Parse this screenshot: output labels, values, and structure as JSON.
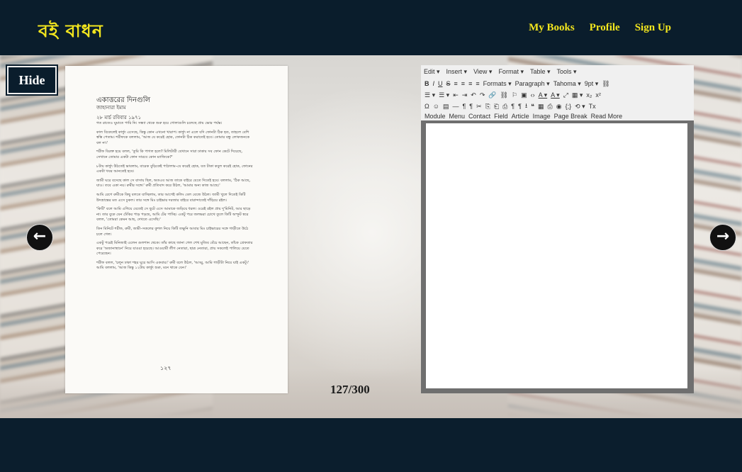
{
  "header": {
    "logo": "বই বাধন",
    "nav": [
      "My Books",
      "Profile",
      "Sign Up"
    ]
  },
  "controls": {
    "hide_label": "Hide",
    "prev_icon": "arrow-left-icon",
    "next_icon": "arrow-right-icon",
    "page_counter": "127/300"
  },
  "book_page": {
    "title": "একাত্তরের দিনগুলি",
    "author": "জাহানারা ইমাম",
    "date_line": "২৮ মার্চ রবিবার ১৯৭১",
    "paragraphs": [
      "গত রাতেও ঘুমাতে পারি নি। সন্ধ্যা থেকে শুরু হয়ে গোলাগুলি চলেছে প্রায় ভোর পর্যন্ত।",
      "কাল বিকেলেই কার্ফ্যু এসেছে, কিন্তু কোন এখনো খারাপ। কার্ফ্যু না এলে যদি ফোনটা ঠিক হত, তাহলে বেশি স্বস্তি পেতাম। শরীফকে বললাম, 'আজ যে করেই হোক, ফোনটা ঠিক করাতেই হবে। তোমার বন্ধু লোকজনকে বল না।'",
      "শরীফ বিরক্ত হয়ে বলল, 'তুমি কি পাগল হলে? মিলিটারী যেখানে সারা ঢাকায় সব ফোন কেটে দিয়েছে, সেখানে তোমার একটা ফোন সারবে কোন ম্যাজিকে?'",
      "৮টায় কার্ফ্যু উঠতেই ভাবলাম, বারেক বুড়িকেই পাঠালাম–যে করেই হোক, যত টাকা কবুল করেই হোক, ফোনের একটা খবর আনতেই হবে।",
      "জামী ঘরে বসেছে কাল সে বাসায় ছিল, অতএব আজ তাকে বাইরে যেতে দিতেই হবে। বললাম, 'ঠিক আছে, যাও। তবে একা নয়। রুমীর সঙ্গে।' রুমী প্রতিবাদ করে উঠল, 'আমার অন্য কাজ আছে।'",
      "আমি রেগে রুমীকে কিছু বলতে যাচ্ছিলাম, তার আগেই কলিং বেল বেজে উঠল। জামী খুলে দিতেই কিটি উদভ্রান্তের মত এসে ঢুকল। তার সঙ্গে মিঃ চাইভার দরজার বাইরে বারান্দাতেই দাঁড়িয়ে রইল।",
      "'কিটি' বলে আমি এগিয়ে যেতেই সে ছুটে এসে আমাকে জড়িয়ে ধরল। ওরেই রইল প্রায় দু'মিনিট, আর ছাড়ে না। তার বুকে যেন ঢেঁকির পাড় পড়ছে, আমি টের পাচ্ছি। একটু পরে জলভরা চোখে তুলে কিটি অস্ফুট স্বরে বলল, 'তোমরা কেমন আছ, দেখতে এসেছি।'",
      "তিন মিনিটে শরীফ, রুমী, জামী–সকলের কুশল নিয়ে কিটি তক্ষুনি আবার মিঃ চাইভারের সঙ্গে গাড়ীতে উঠে চলে গেল।",
      "একটু পরেই মিনিজাই এলেন গুলশান থেকে। তাঁর কাছে জানা গেল শেখ মুজিব বেঁচে আছেন, তাঁকে গ্রেফতার করে 'অজানাস্থানে' নিয়ে যাওয়া হয়েছে। আওয়ামী লীগ নেতারা, ছাত্র নেতারা, প্রায় সকলেই পালিয়ে যেতে পেরেছেন।",
      "শরীফ বলল, 'চলুন ঢাকা শহর ঘুরে আসি একবার।' রুমী বলে উঠল, 'আব্বু, আমি গাড়ীটা নিয়ে যাই একটু।' আমি বললাম, 'আজ কিন্তু ১২টায় কার্ফ্যু শুরু, মনে থাকে যেন।'"
    ],
    "page_number": "১২৭"
  },
  "editor": {
    "menu": [
      "Edit ▾",
      "Insert ▾",
      "View ▾",
      "Format ▾",
      "Table ▾",
      "Tools ▾"
    ],
    "toolbar1": [
      "B",
      "I",
      "U",
      "S",
      "≡",
      "≡",
      "≡",
      "≡",
      "Formats ▾",
      "Paragraph ▾",
      "Tahoma ▾",
      "9pt ▾",
      "⛓"
    ],
    "toolbar2": [
      "☰ ▾",
      "☰ ▾",
      "⇤",
      "⇥",
      "↶",
      "↷",
      "🔗",
      "⛓",
      "⚐",
      "▣",
      "‹›",
      "A ▾",
      "A ▾",
      "⤢",
      "▦ ▾",
      "x₂",
      "x²"
    ],
    "toolbar3": [
      "Ω",
      "☺",
      "▤",
      "—",
      "¶",
      "¶",
      "✂",
      "⎘",
      "⎗",
      "⎙",
      "¶",
      "¶",
      "⭳",
      "❝",
      "▦",
      "⎙",
      "◉",
      "{;}",
      "⟲ ▾",
      "Tx"
    ],
    "toolbar4": [
      "Module",
      "Menu",
      "Contact",
      "Field",
      "Article",
      "Image",
      "Page Break",
      "Read More"
    ]
  }
}
